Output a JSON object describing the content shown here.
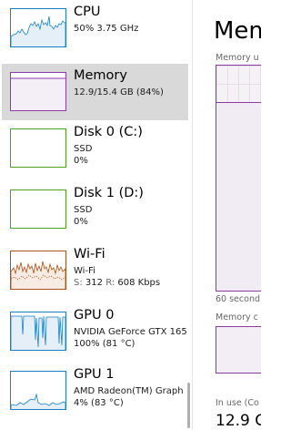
{
  "colors": {
    "cpu": "#1b7fc4",
    "memory": "#8b3ca4",
    "disk": "#4da01e",
    "wifi": "#a5521c",
    "gpu": "#1b7fc4",
    "selected_bg": "#d9d9d9"
  },
  "sidebar": {
    "items": [
      {
        "title": "CPU",
        "line1": "50%  3.75 GHz",
        "icon": "cpu-graph-icon"
      },
      {
        "title": "Memory",
        "line1": "12.9/15.4 GB (84%)",
        "icon": "memory-graph-icon"
      },
      {
        "title": "Disk 0 (C:)",
        "line1": "SSD",
        "line2": "0%",
        "icon": "disk-graph-icon"
      },
      {
        "title": "Disk 1 (D:)",
        "line1": "SSD",
        "line2": "0%",
        "icon": "disk-graph-icon"
      },
      {
        "title": "Wi-Fi",
        "line1": "Wi-Fi",
        "send_label": "S:",
        "send_value": "312",
        "recv_label": "R:",
        "recv_value": "608 Kbps",
        "icon": "wifi-graph-icon"
      },
      {
        "title": "GPU 0",
        "line1": "NVIDIA GeForce GTX 165",
        "line2": "100%  (81 °C)",
        "icon": "gpu-graph-icon"
      },
      {
        "title": "GPU 1",
        "line1": "AMD Radeon(TM) Graph",
        "line2": "4%  (83 °C)",
        "icon": "gpu-graph-icon"
      }
    ]
  },
  "detail": {
    "title": "Mem",
    "usage_label": "Memory u",
    "time_label": "60 second",
    "composition_label": "Memory c",
    "in_use_label": "In use (Co",
    "in_use_value": "12.9 G",
    "memory_usage_percent": 84
  }
}
